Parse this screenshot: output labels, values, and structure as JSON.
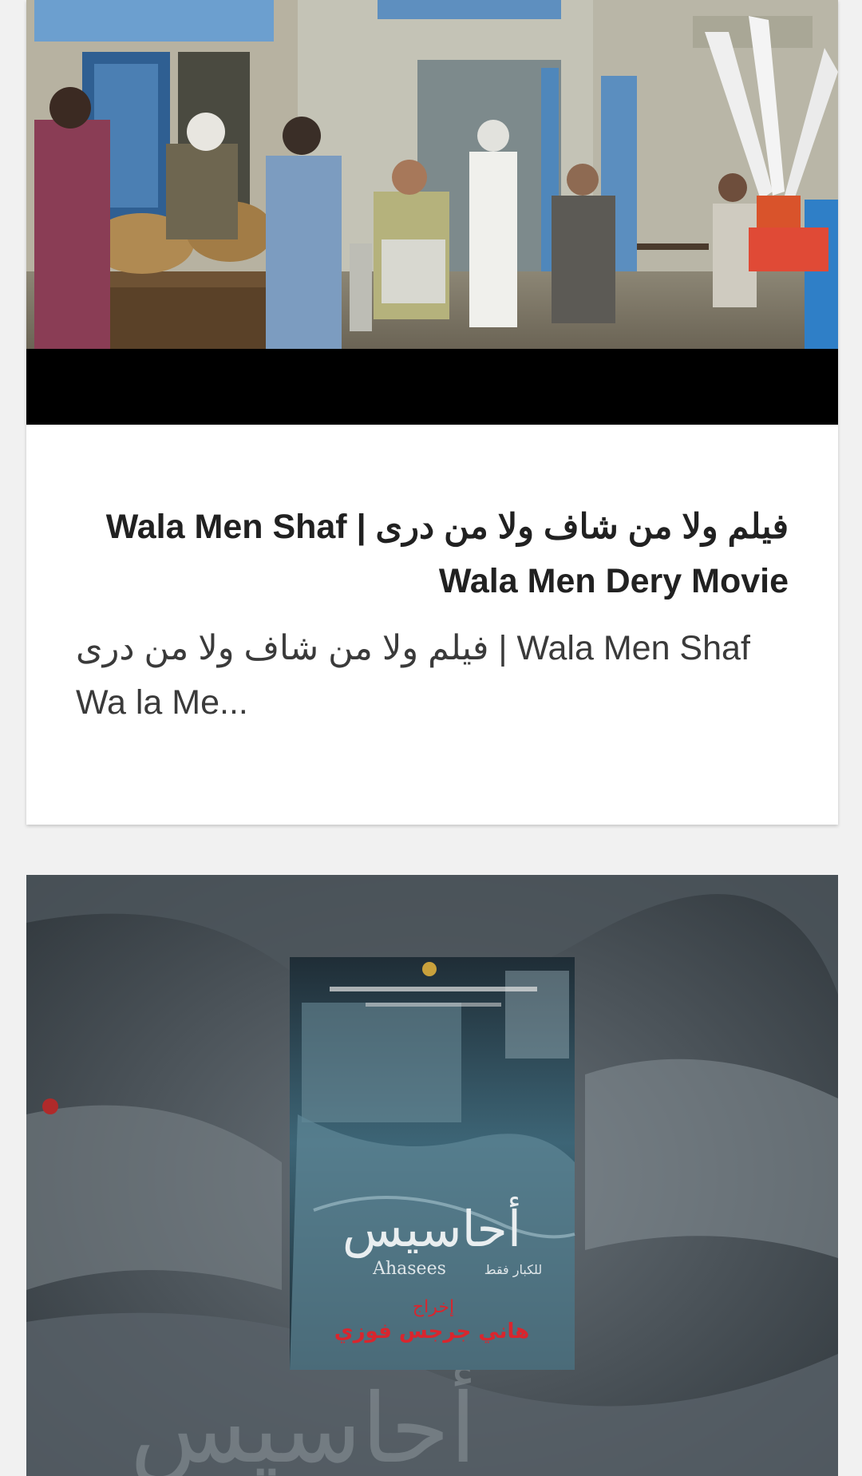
{
  "feed": {
    "cards": [
      {
        "thumbnail_alt": "street-scene-thumbnail",
        "title": "فيلم ولا من شاف ولا من درى | Wala Men Shaf Wala Men Dery Movie",
        "description": "فيلم ولا من شاف ولا من درى | Wala Men Shaf Wa la Me..."
      },
      {
        "thumbnail_alt": "ahasees-poster-thumbnail",
        "poster": {
          "title_ar": "أحاسيس",
          "title_en": "Ahasees",
          "rating_note": "للكبار فقط",
          "director_label": "إخراج",
          "director_name": "هاني جرجس فوزي"
        }
      }
    ]
  },
  "colors": {
    "page_background": "#f1f1f1",
    "card_background": "#ffffff",
    "title_text": "#212121",
    "description_text": "#3a3a3a"
  }
}
